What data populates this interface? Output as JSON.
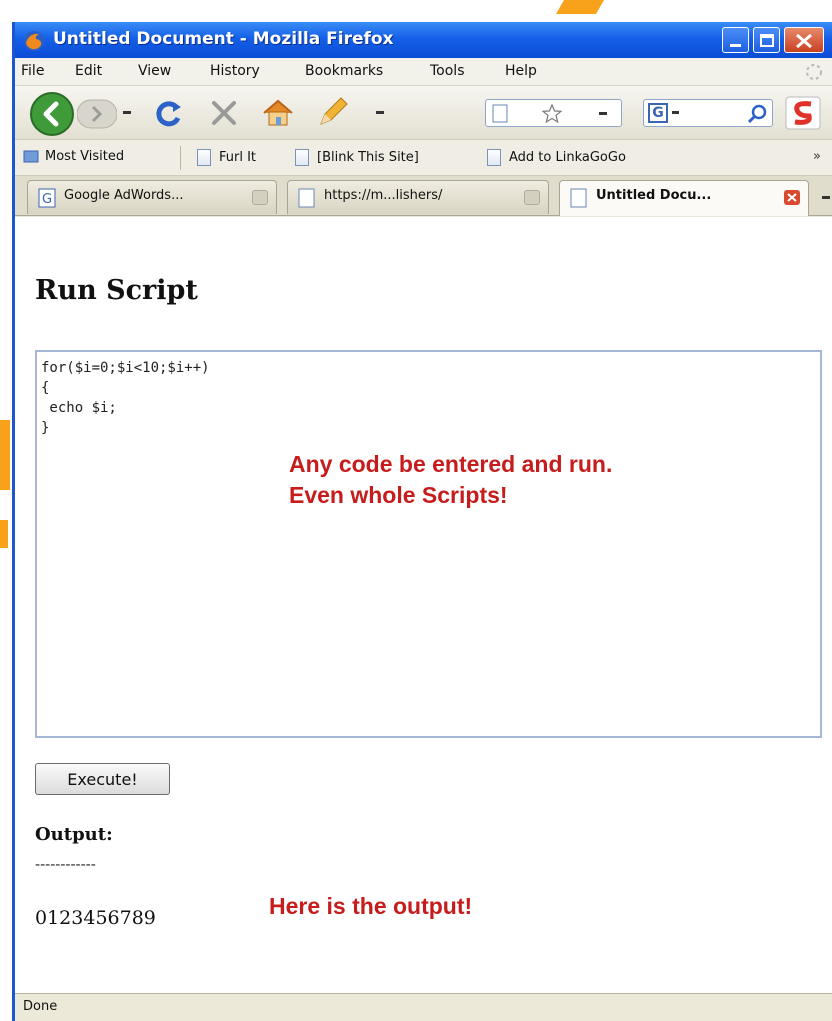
{
  "window": {
    "title": "Untitled Document - Mozilla Firefox"
  },
  "menu": {
    "items": [
      {
        "label": "File"
      },
      {
        "label": "Edit"
      },
      {
        "label": "View"
      },
      {
        "label": "History"
      },
      {
        "label": "Bookmarks"
      },
      {
        "label": "Tools"
      },
      {
        "label": "Help"
      }
    ]
  },
  "toolbar": {
    "address_value": "",
    "search_engine": "G"
  },
  "bookmarks": {
    "items": [
      {
        "label": "Most Visited"
      },
      {
        "label": "Furl It"
      },
      {
        "label": "[Blink This Site]"
      },
      {
        "label": "Add to LinkaGoGo"
      }
    ],
    "overflow": "»"
  },
  "tabs": [
    {
      "label": "Google AdWords...",
      "active": false
    },
    {
      "label": "https://m...lishers/",
      "active": false
    },
    {
      "label": "Untitled Docu...",
      "active": true
    }
  ],
  "page": {
    "heading": "Run Script",
    "code_lines": [
      "for($i=0;$i<10;$i++)",
      "{",
      " echo $i;",
      "}"
    ],
    "note_line1": "Any code be entered and run.",
    "note_line2": "Even whole Scripts!",
    "execute_label": "Execute!",
    "output_label": "Output:",
    "separator": "------------",
    "output_value": "0123456789",
    "output_note": "Here is the output!"
  },
  "status": {
    "text": "Done"
  },
  "colors": {
    "accent_red": "#c71c1c",
    "titlebar_blue": "#1560e8",
    "watermark_orange": "#f7a21a"
  }
}
